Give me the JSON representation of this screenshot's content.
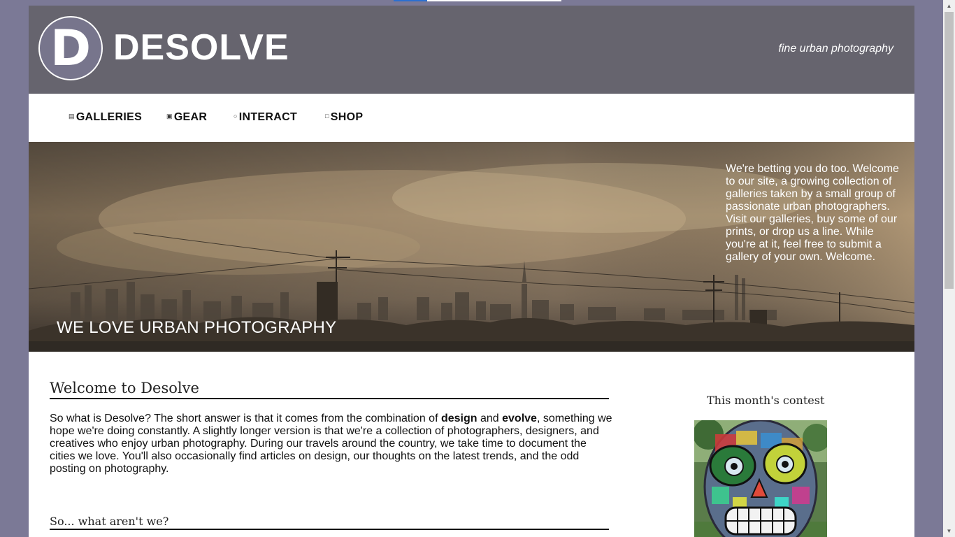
{
  "brand": {
    "logo_letter": "D",
    "name": "DESOLVE",
    "tagline": "fine urban photography"
  },
  "nav": {
    "items": [
      {
        "label": "GALLERIES",
        "icon": "gallery-icon"
      },
      {
        "label": "GEAR",
        "icon": "camera-icon"
      },
      {
        "label": "INTERACT",
        "icon": "chat-icon"
      },
      {
        "label": "SHOP",
        "icon": "cart-icon"
      }
    ]
  },
  "hero": {
    "blurb": "We're betting you do too. Welcome to our site, a growing collection of galleries taken by a small group of passionate urban photographers. Visit our galleries, buy some of our prints, or drop us a line. While you're at it, feel free to submit a gallery of your own. Welcome.",
    "title": "WE LOVE URBAN PHOTOGRAPHY"
  },
  "main": {
    "welcome_heading": "Welcome to Desolve",
    "welcome_p1": "So what is Desolve? The short answer is that it comes from the combination of ",
    "welcome_b1": "design",
    "welcome_and": " and ",
    "welcome_b2": "evolve",
    "welcome_p2": ", something we hope we're doing constantly. A slightly longer version is that we're a collection of photographers, designers, and creatives who enjoy urban photography. During our travels around the country, we take time to document the cities we love. You'll also occasionally find articles on design, our thoughts on the latest trends, and the odd posting on photography.",
    "sub_heading": "So... what aren't we?"
  },
  "sidebar": {
    "contest_title": "This month's contest"
  },
  "colors": {
    "page_bg": "#7b7996",
    "header_bg": "#66646e",
    "logo_bg": "#77758c"
  }
}
